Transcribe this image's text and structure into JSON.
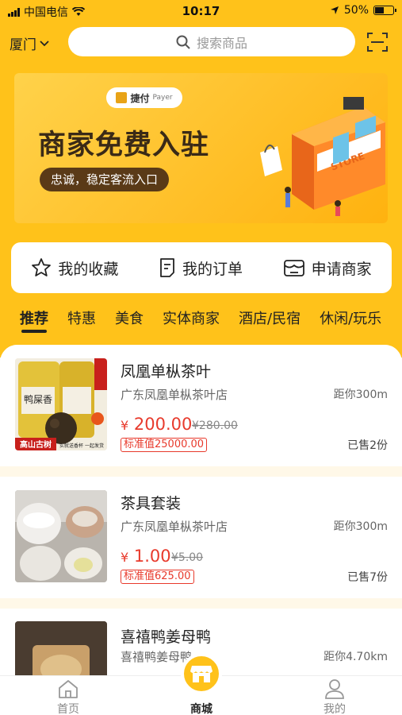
{
  "status_bar": {
    "carrier": "中国电信",
    "time": "10:17",
    "battery": "50%"
  },
  "header": {
    "city": "厦门",
    "search_placeholder": "搜索商品"
  },
  "banner": {
    "logo_text": "捷付",
    "logo_sub": "Payer",
    "title": "商家免费入驻",
    "subtitle": "忠诚，稳定客流入口",
    "store_sign": "STORE"
  },
  "quick_actions": [
    {
      "label": "我的收藏",
      "icon": "star-icon"
    },
    {
      "label": "我的订单",
      "icon": "order-icon"
    },
    {
      "label": "申请商家",
      "icon": "store-icon"
    }
  ],
  "tabs": [
    "推荐",
    "特惠",
    "美食",
    "实体商家",
    "酒店/民宿",
    "休闲/玩乐"
  ],
  "active_tab": 0,
  "products": [
    {
      "name": "凤凰单枞茶叶",
      "shop": "广东凤凰单枞茶叶店",
      "distance": "距你300m",
      "currency": "¥",
      "price": "200.00",
      "old_price": "¥280.00",
      "standard": "标准值25000.00",
      "sold": "已售2份",
      "thumb_caption": "高山古树",
      "thumb_caption2": "实就送香杯 一起发货",
      "thumb_label": "鸭屎香"
    },
    {
      "name": "茶具套装",
      "shop": "广东凤凰单枞茶叶店",
      "distance": "距你300m",
      "currency": "¥",
      "price": "1.00",
      "old_price": "¥5.00",
      "standard": "标准值625.00",
      "sold": "已售7份"
    },
    {
      "name": "喜禧鸭姜母鸭",
      "shop": "喜禧鸭姜母鸭",
      "distance": "距你4.70km"
    }
  ],
  "bottom_nav": [
    {
      "label": "首页",
      "icon": "home-icon"
    },
    {
      "label": "商城",
      "icon": "mall-icon"
    },
    {
      "label": "我的",
      "icon": "user-icon"
    }
  ],
  "colors": {
    "brand_yellow": "#ffc21a",
    "price_red": "#e83a2c"
  }
}
